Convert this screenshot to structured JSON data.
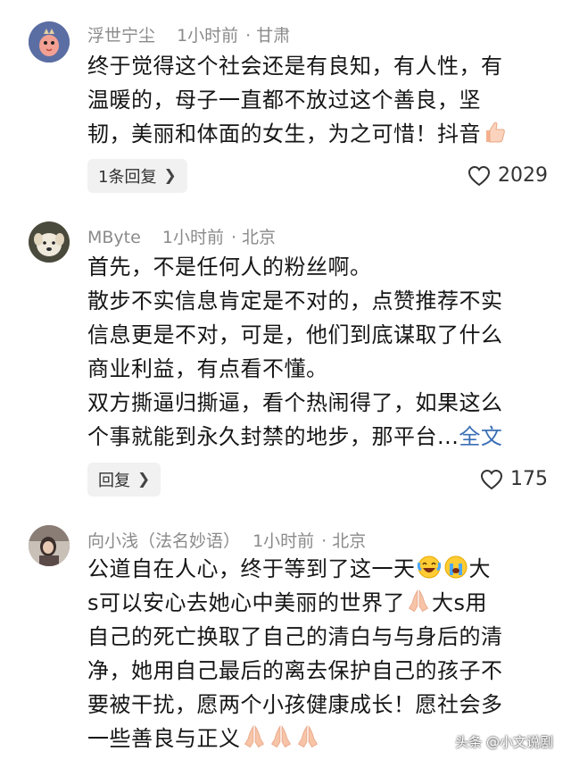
{
  "comments": [
    {
      "user": "浮世宁尘",
      "time": "1小时前",
      "location": "甘肃",
      "lines": [
        "终于觉得这个社会还是有良知，有人性，有",
        "温暖的，母子一直都不放过这个善良，坚",
        "韧，美丽和体面的女生，为之可惜！抖音"
      ],
      "reply_label": "1条回复",
      "likes": "2029"
    },
    {
      "user": "MByte",
      "time": "1小时前",
      "location": "北京",
      "paragraphs": [
        [
          "首先，不是任何人的粉丝啊。"
        ],
        [
          "散步不实信息肯定是不对的，点赞推荐不实",
          "信息更是不对，可是，他们到底谋取了什么",
          "商业利益，有点看不懂。"
        ],
        [
          "双方撕逼归撕逼，看个热闹得了，如果这么",
          "个事就能到永久封禁的地步，那平台..."
        ]
      ],
      "more_label": "全文",
      "reply_label": "回复",
      "likes": "175"
    },
    {
      "user": "向小浅（法名妙语）",
      "time": "1小时前",
      "location": "北京",
      "segments": {
        "l1a": "公道自在人心，终于等到了这一天",
        "l1b": "大",
        "l2a": "s可以安心去她心中美丽的世界了",
        "l2b": "大s用",
        "l3": "自己的死亡换取了自己的清白与与身后的清",
        "l4": "净，她用自己最后的离去保护自己的孩子不",
        "l5": "要被干扰，愿两个小孩健康成长！愿社会多",
        "l6": "一些善良与正义"
      }
    }
  ],
  "watermark": "头条 @小文说剧",
  "icons": [
    "heart-outline-icon",
    "chevron-right-icon",
    "thumbs-up-emoji",
    "laughing-crying-emoji",
    "sobbing-emoji",
    "praying-hands-emoji"
  ],
  "colors": {
    "meta": "#8a8a8a",
    "link": "#3b6fb6",
    "reply_bg": "#f1f1f1"
  }
}
